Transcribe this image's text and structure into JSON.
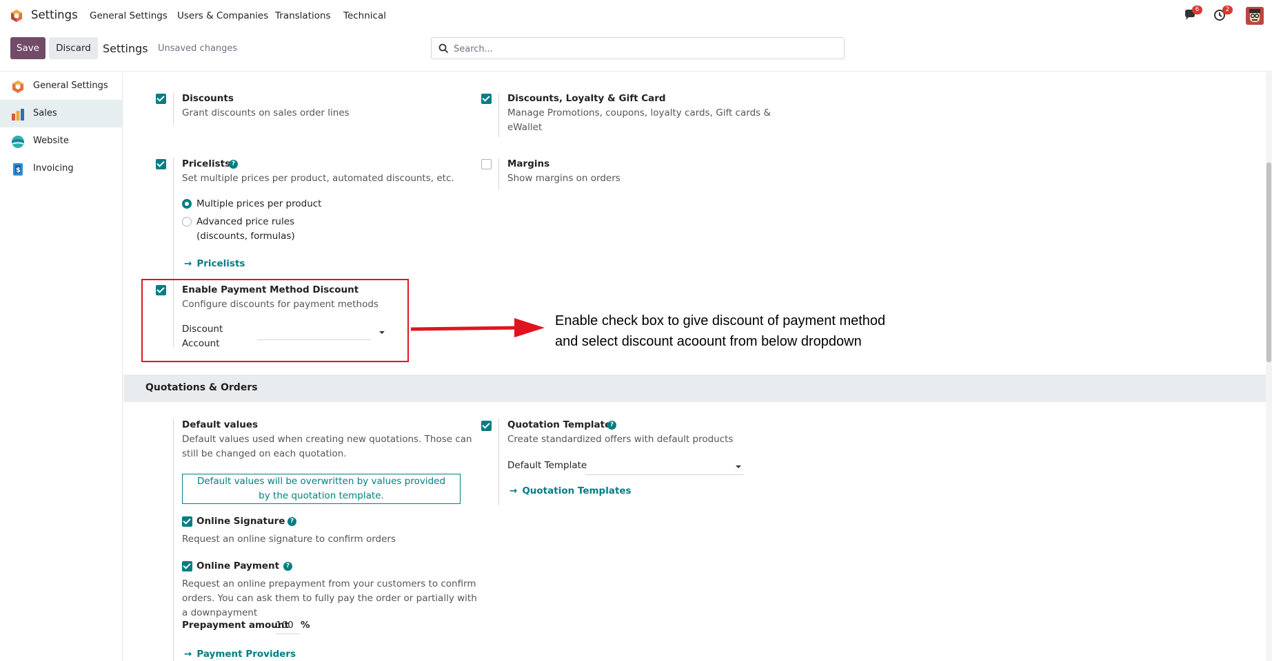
{
  "topnav": {
    "app_title": "Settings",
    "menu": [
      "General Settings",
      "Users & Companies",
      "Translations",
      "Technical"
    ],
    "messages_badge": "6",
    "activity_badge": "2"
  },
  "control_panel": {
    "save_label": "Save",
    "discard_label": "Discard",
    "title": "Settings",
    "status": "Unsaved changes",
    "search_placeholder": "Search..."
  },
  "sidebar": {
    "items": [
      {
        "label": "General Settings",
        "icon": "odoo-logo-icon"
      },
      {
        "label": "Sales",
        "icon": "sales-app-icon",
        "active": true
      },
      {
        "label": "Website",
        "icon": "website-app-icon"
      },
      {
        "label": "Invoicing",
        "icon": "invoicing-app-icon"
      }
    ]
  },
  "settings": {
    "discounts": {
      "title": "Discounts",
      "desc": "Grant discounts on sales order lines",
      "checked": true
    },
    "loyalty": {
      "title": "Discounts, Loyalty & Gift Card",
      "desc_line1": "Manage Promotions, coupons, loyalty cards, Gift cards &",
      "desc_line2": "eWallet",
      "checked": true
    },
    "pricelists": {
      "title": "Pricelists",
      "desc": "Set multiple prices per product, automated discounts, etc.",
      "checked": true,
      "option1": "Multiple prices per product",
      "option2_line1": "Advanced price rules",
      "option2_line2": "(discounts, formulas)",
      "link": "Pricelists"
    },
    "margins": {
      "title": "Margins",
      "desc": "Show margins on orders",
      "checked": false
    },
    "payment_discount": {
      "title": "Enable Payment Method Discount",
      "desc": "Configure discounts for payment methods",
      "field_label_line1": "Discount",
      "field_label_line2": "Account",
      "checked": true
    },
    "annotation_line1": "Enable check box to give discount of payment method",
    "annotation_line2": "and select discount acoount from below dropdown"
  },
  "quotations": {
    "section_title": "Quotations & Orders",
    "default_values": {
      "title": "Default values",
      "desc_line1": "Default values used when creating new quotations. Those can",
      "desc_line2": "still be changed on each quotation.",
      "info_line1": "Default values will be overwritten by values provided",
      "info_line2": "by the quotation template."
    },
    "online_signature": {
      "title": "Online Signature",
      "desc": "Request an online signature to confirm orders",
      "checked": true
    },
    "online_payment": {
      "title": "Online Payment",
      "desc_line1": "Request an online prepayment from your customers to confirm",
      "desc_line2": "orders. You can ask them to fully pay the order or partially with",
      "desc_line3": "a downpayment",
      "checked": true,
      "prepayment_label": "Prepayment amount",
      "prepayment_value": "100",
      "prepayment_unit": "%",
      "link": "Payment Providers"
    },
    "templates": {
      "title": "Quotation Templates",
      "desc": "Create standardized offers with default products",
      "checked": true,
      "field_label": "Default Template",
      "link": "Quotation Templates"
    }
  },
  "colors": {
    "brand": "#714b67",
    "accent": "#017e84",
    "annotation_red": "#e0141e"
  }
}
